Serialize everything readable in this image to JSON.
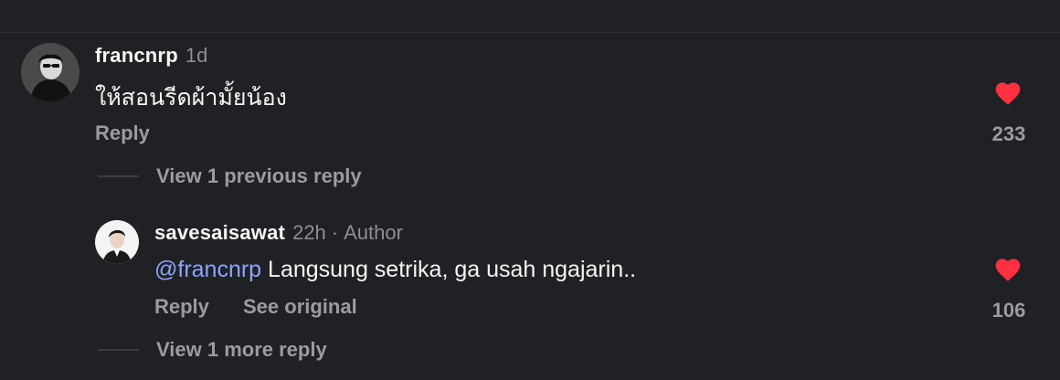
{
  "comment": {
    "username": "francnrp",
    "time": "1d",
    "text": "ให้สอนรีดผ้ามั้ยน้อง",
    "reply_label": "Reply",
    "likes": "233",
    "view_replies": "View 1 previous reply"
  },
  "reply": {
    "username": "savesaisawat",
    "time": "22h",
    "separator": "·",
    "author_badge": "Author",
    "mention": "@francnrp",
    "text": " Langsung setrika, ga usah ngajarin..",
    "reply_label": "Reply",
    "see_original_label": "See original",
    "likes": "106",
    "view_replies": "View 1 more reply"
  },
  "colors": {
    "background": "#202124",
    "heart": "#ff3040",
    "mention": "#8ea4ff",
    "muted": "#9b9ba0"
  },
  "icons": {
    "like": "heart-icon"
  }
}
